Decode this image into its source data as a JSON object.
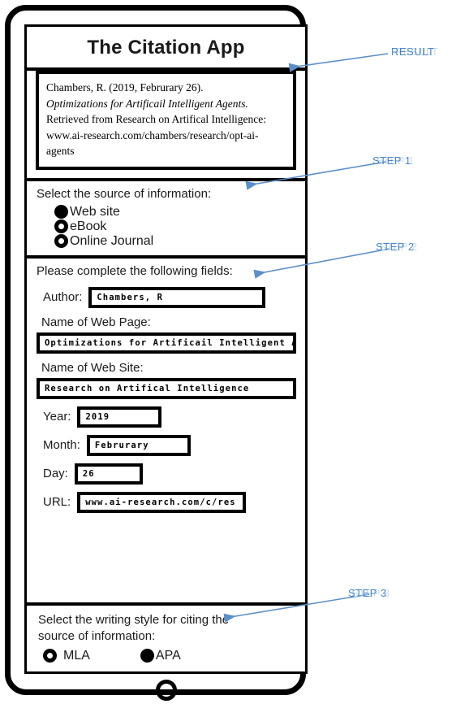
{
  "app": {
    "title": "The Citation App"
  },
  "result": {
    "lines": [
      "Chambers, R. (2019, Februrary 26).",
      "Optimizations for Artificail Intelligent Agents.",
      "Retrieved from Research on Artifical Intelligence:",
      "www.ai-research.com/chambers/research/opt-ai-",
      "agents"
    ]
  },
  "step1": {
    "prompt": "Select the source of information:",
    "options": [
      {
        "label": "Web site",
        "selected": true
      },
      {
        "label": "eBook",
        "selected": false
      },
      {
        "label": "Online Journal",
        "selected": false
      }
    ]
  },
  "step2": {
    "prompt": "Please complete the following fields:",
    "fields": [
      {
        "label": "Author:",
        "value": "Chambers, R"
      },
      {
        "label": "Name of Web Page:",
        "value": "Optimizations for Artificail Intelligent Agents"
      },
      {
        "label": "Name of Web Site:",
        "value": "Research on Artifical Intelligence"
      },
      {
        "label": "Year:",
        "value": "2019"
      },
      {
        "label": "Month:",
        "value": "Februrary"
      },
      {
        "label": "Day:",
        "value": "26"
      },
      {
        "label": "URL:",
        "value": "www.ai-research.com/c/res"
      }
    ]
  },
  "step3": {
    "prompt_line1": "Select the writing style for citing the",
    "prompt_line2": "source of information:",
    "options": [
      {
        "label": "MLA",
        "selected": false
      },
      {
        "label": "APA",
        "selected": true
      }
    ]
  },
  "annotations": [
    {
      "label": "RESULT"
    },
    {
      "label": "STEP 1"
    },
    {
      "label": "STEP 2"
    },
    {
      "label": "STEP 3"
    }
  ],
  "colors": {
    "arrow": "#5b8fc9",
    "annotation": "#4a87c4",
    "annotation_ghost": "#c9dcef",
    "frame": "#000000"
  }
}
